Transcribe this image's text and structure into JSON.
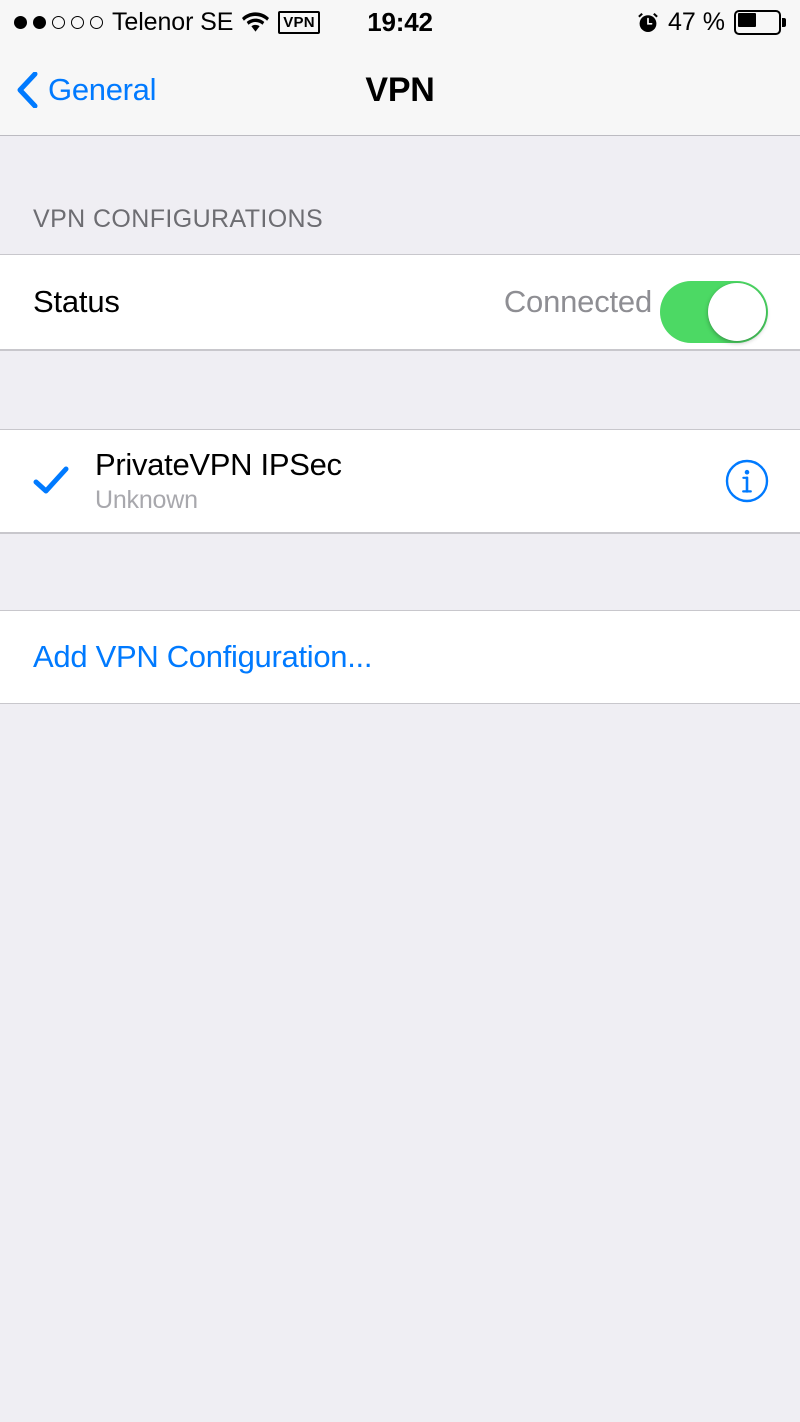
{
  "status_bar": {
    "signal": {
      "name": "signal-strength",
      "total_dots": 5,
      "filled_dots": 2
    },
    "carrier": "Telenor SE",
    "wifi_icon": "wifi-icon",
    "vpn_badge": "VPN",
    "time": "19:42",
    "alarm_icon": "alarm-clock-icon",
    "battery_percent": "47 %",
    "battery_level": 47,
    "battery_icon": "battery-icon"
  },
  "nav": {
    "back_icon": "chevron-left-icon",
    "back_label": "General",
    "title": "VPN"
  },
  "main": {
    "section_header": "VPN CONFIGURATIONS",
    "status_row": {
      "label": "Status",
      "value": "Connected",
      "toggle_name": "vpn-status-toggle",
      "toggle_on": true,
      "toggle_color": "#4CD964"
    },
    "configurations": [
      {
        "selected": true,
        "check_icon": "checkmark-icon",
        "title": "PrivateVPN IPSec",
        "subtitle": "Unknown",
        "info_icon": "info-circle-icon"
      }
    ],
    "add_row": {
      "label": "Add VPN Configuration..."
    }
  },
  "colors": {
    "accent_blue": "#007AFF",
    "toggle_green": "#4CD964",
    "background": "#EFEEF3",
    "row_background": "#FFFFFF",
    "separator": "#C8C7CC",
    "secondary_text": "#8E8E93"
  }
}
